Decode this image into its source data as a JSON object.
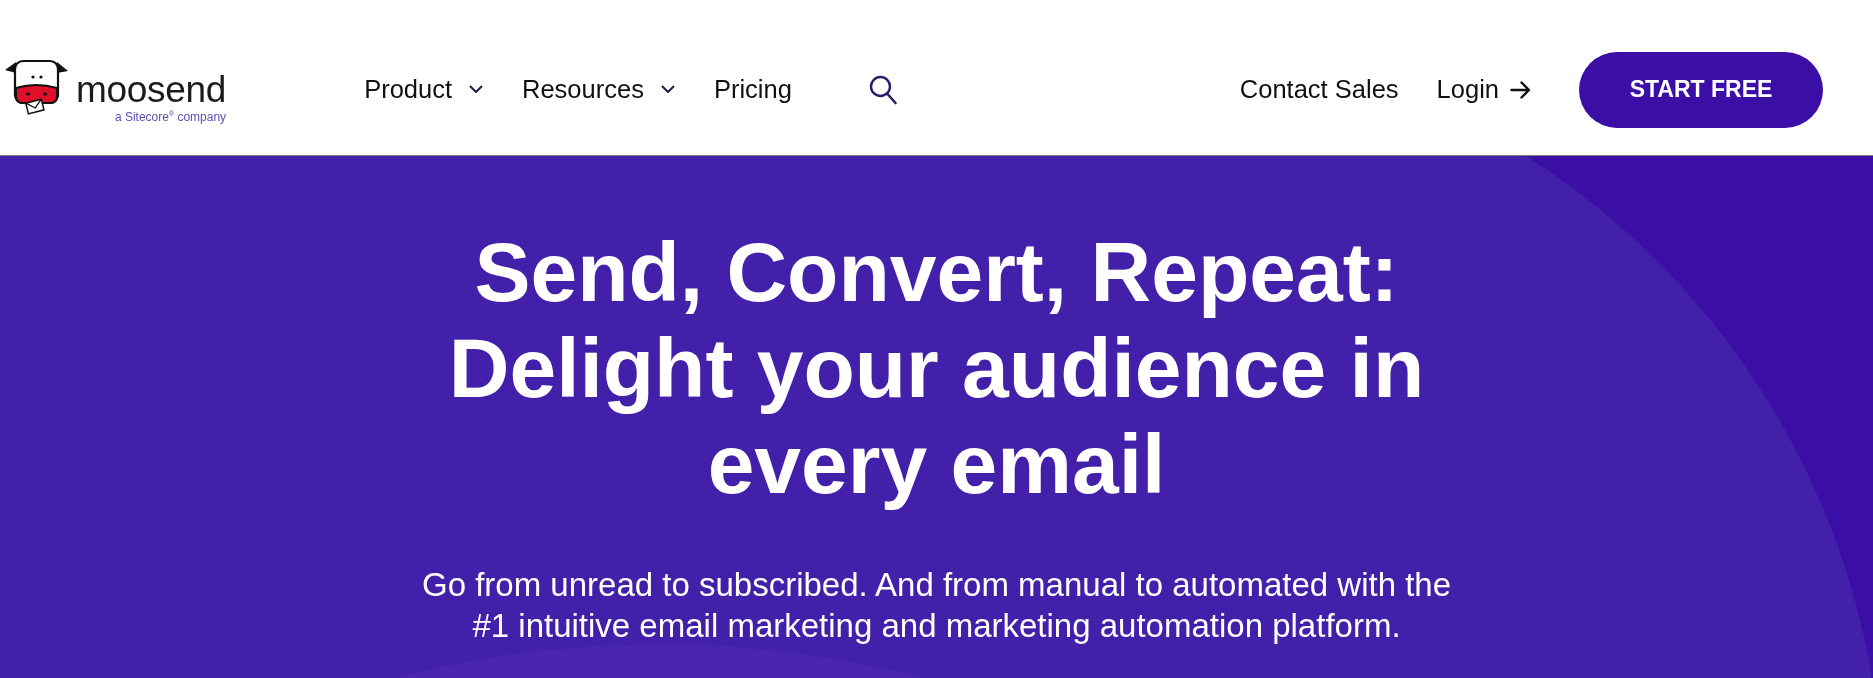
{
  "header": {
    "logo": {
      "name": "moosend",
      "tagline": "a Sitecore$^{®}$ company"
    },
    "nav": [
      {
        "label": "Product",
        "kind": "dropdown"
      },
      {
        "label": "Resources",
        "kind": "dropdown"
      },
      {
        "label": "Pricing",
        "kind": "link"
      }
    ],
    "actions": [
      {
        "label": "Contact Sales",
        "kind": "link"
      },
      {
        "label": "Login",
        "kind": "arrow-link"
      }
    ],
    "cta": {
      "label": "START FREE"
    }
  },
  "hero": {
    "title": "Send, Convert, Repeat: Delight your audience in every email",
    "subtitle": "Go from unread to subscribed. And from manual to automated with the #1 intuitive email marketing and marketing automation platform."
  }
}
